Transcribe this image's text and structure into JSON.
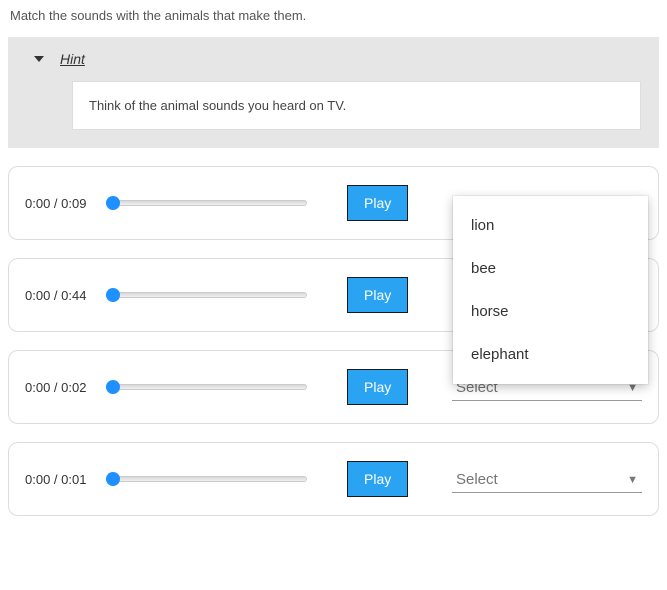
{
  "instruction": "Match the sounds with the animals that make them.",
  "hint": {
    "label": "Hint",
    "content": "Think of the animal sounds you heard on TV."
  },
  "play_label": "Play",
  "select_placeholder": "Select",
  "rows": [
    {
      "time": "0:00 / 0:09",
      "dropdown_open": true
    },
    {
      "time": "0:00 / 0:44",
      "dropdown_open": false
    },
    {
      "time": "0:00 / 0:02",
      "dropdown_open": false
    },
    {
      "time": "0:00 / 0:01",
      "dropdown_open": false
    }
  ],
  "options": [
    "lion",
    "bee",
    "horse",
    "elephant"
  ]
}
